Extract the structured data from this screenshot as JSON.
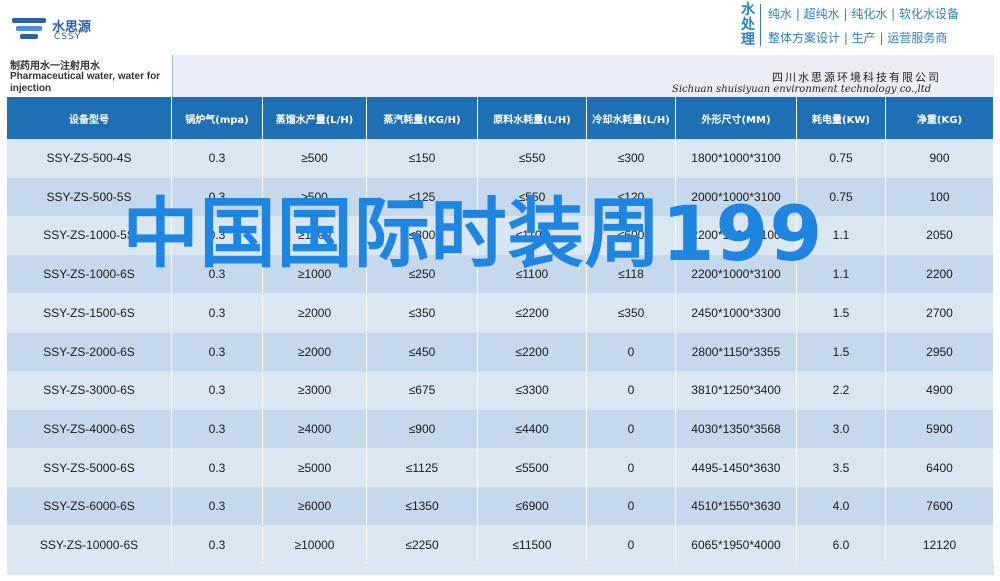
{
  "header": {
    "logo_cn": "水思源",
    "logo_en": "CSSY",
    "brand_vertical": "水处理",
    "brand_line1": "纯水 | 超纯水 | 纯化水 | 软化水设备",
    "brand_line2": "整体方案设计 | 生产 | 运营服务商"
  },
  "table": {
    "title_cn": "制药用水一注射用水",
    "title_en": "Pharmaceutical water, water for injection",
    "company_cn": "四川水思源环境科技有限公司",
    "company_en": "Sichuan shuisiyuan environment technology co.,ltd",
    "columns": [
      "设备型号",
      "锅炉气(mpa)",
      "蒸馏水产量(L/H)",
      "蒸汽耗量(KG/H)",
      "原料水耗量(L/H)",
      "冷却水耗量(L/H)",
      "外形尺寸(MM)",
      "耗电量(KW)",
      "净重(KG)"
    ],
    "rows": [
      [
        "SSY-ZS-500-4S",
        "0.3",
        "≥500",
        "≤150",
        "≤550",
        "≤300",
        "1800*1000*3100",
        "0.75",
        "900"
      ],
      [
        "SSY-ZS-500-5S",
        "0.3",
        "≥500",
        "≤125",
        "≤550",
        "≤120",
        "2000*1000*3100",
        "0.75",
        "100"
      ],
      [
        "SSY-ZS-1000-5S",
        "0.3",
        "≥1000",
        "≤300",
        "≤1100",
        "≤600",
        "2200*1000*3100",
        "1.1",
        "2050"
      ],
      [
        "SSY-ZS-1000-6S",
        "0.3",
        "≥1000",
        "≤250",
        "≤1100",
        "≤118",
        "2200*1000*3100",
        "1.1",
        "2200"
      ],
      [
        "SSY-ZS-1500-6S",
        "0.3",
        "≥2000",
        "≤350",
        "≤2200",
        "≤350",
        "2450*1000*3300",
        "1.5",
        "2700"
      ],
      [
        "SSY-ZS-2000-6S",
        "0.3",
        "≥2000",
        "≤450",
        "≤2200",
        "0",
        "2800*1150*3355",
        "1.5",
        "2950"
      ],
      [
        "SSY-ZS-3000-6S",
        "0.3",
        "≥3000",
        "≤675",
        "≤3300",
        "0",
        "3810*1250*3400",
        "2.2",
        "4900"
      ],
      [
        "SSY-ZS-4000-6S",
        "0.3",
        "≥4000",
        "≤900",
        "≤4400",
        "0",
        "4030*1350*3568",
        "3.0",
        "5900"
      ],
      [
        "SSY-ZS-5000-6S",
        "0.3",
        "≥5000",
        "≤1125",
        "≤5500",
        "0",
        "4495-1450*3630",
        "3.5",
        "6400"
      ],
      [
        "SSY-ZS-6000-6S",
        "0.3",
        "≥6000",
        "≤1350",
        "≤6900",
        "0",
        "4510*1550*3630",
        "4.0",
        "7600"
      ],
      [
        "SSY-ZS-10000-6S",
        "0.3",
        "≥10000",
        "≤2250",
        "≤11500",
        "0",
        "6065*1950*4000",
        "6.0",
        "12120"
      ]
    ]
  },
  "overlay": {
    "text": "中国国际时装周199"
  },
  "colors": {
    "header_blue": "#1f6fb4",
    "row_light": "#dbe6f3",
    "row_dark": "#c6d8ec",
    "overlay_blue": "#1e86e0"
  }
}
